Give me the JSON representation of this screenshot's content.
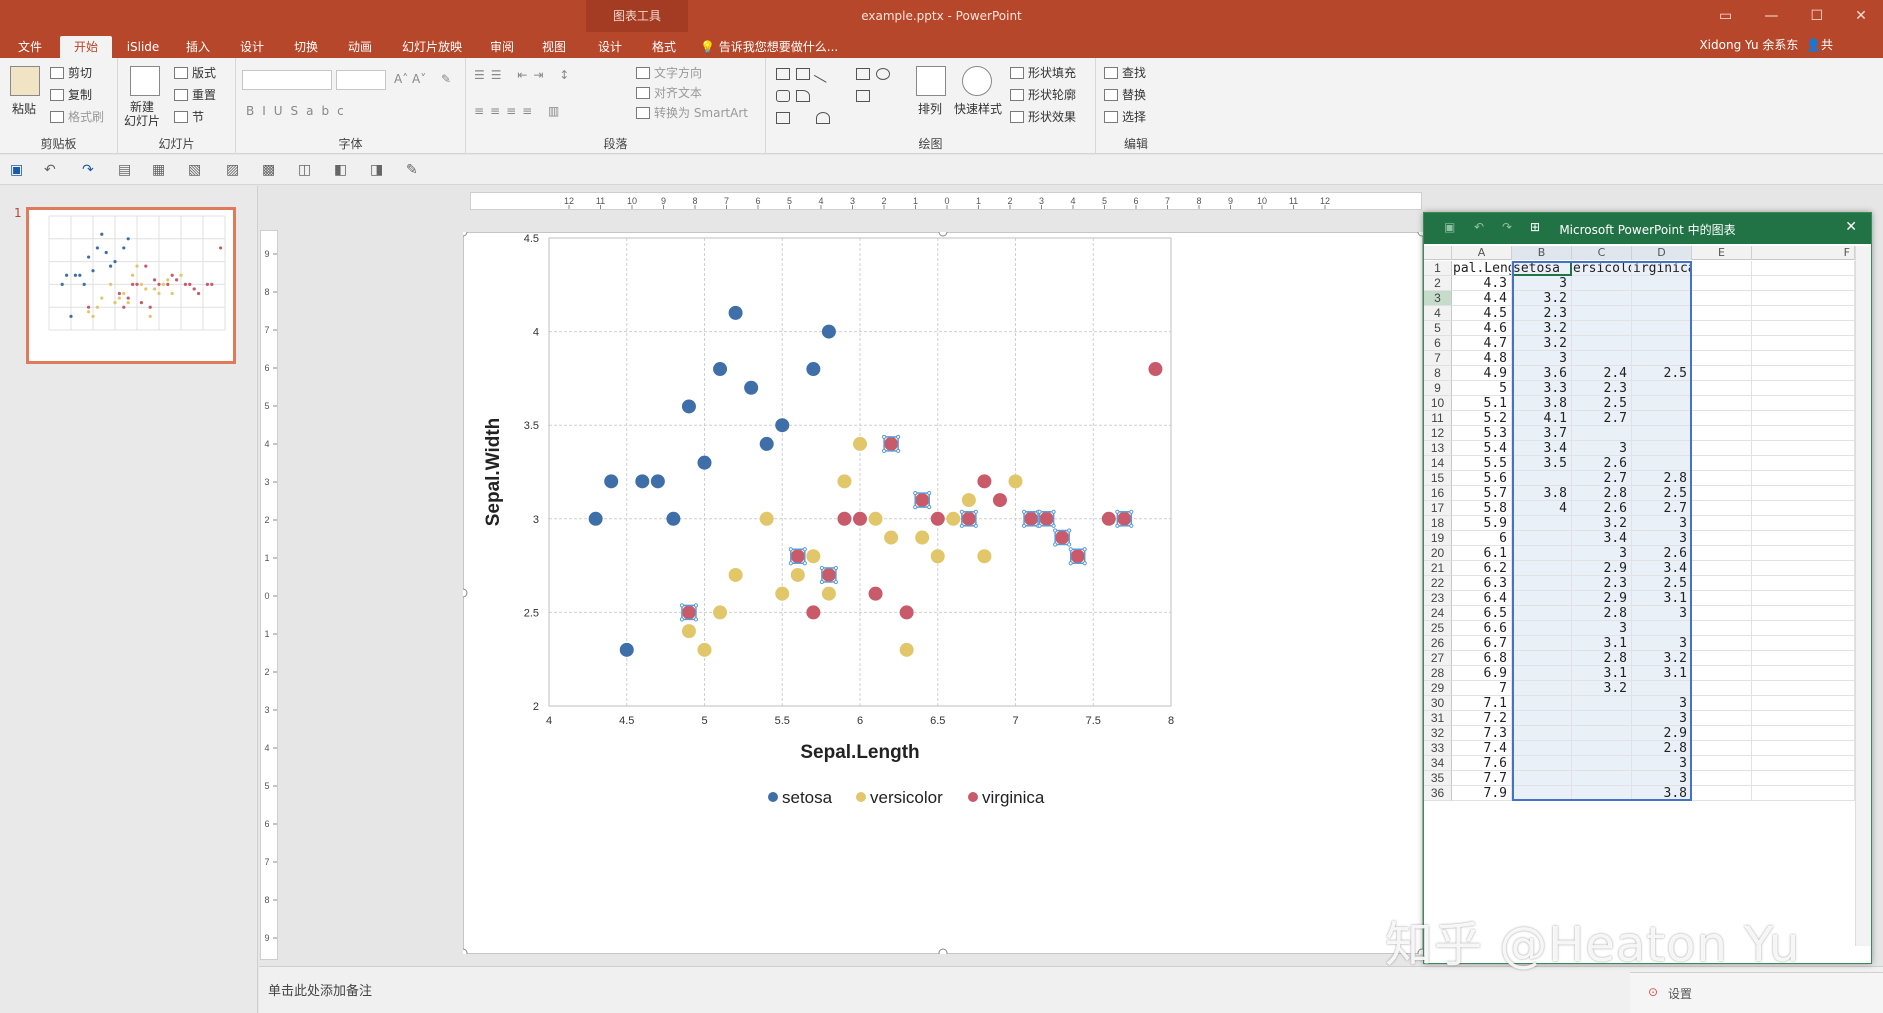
{
  "window": {
    "title": "example.pptx - PowerPoint",
    "chart_tools": "图表工具",
    "user": "Xidong Yu 余系东",
    "share": "共"
  },
  "tabs": [
    "文件",
    "开始",
    "iSlide",
    "插入",
    "设计",
    "切换",
    "动画",
    "幻灯片放映",
    "审阅",
    "视图",
    "设计",
    "格式"
  ],
  "tell_me": "告诉我您想要做什么...",
  "ribbon": {
    "clipboard": {
      "label": "剪贴板",
      "paste": "粘贴",
      "cut": "剪切",
      "copy": "复制",
      "format_painter": "格式刷"
    },
    "slides": {
      "label": "幻灯片",
      "new_slide": "新建\n幻灯片",
      "layout": "版式",
      "reset": "重置",
      "section": "节"
    },
    "font": {
      "label": "字体"
    },
    "paragraph": {
      "label": "段落",
      "text_direction": "文字方向",
      "align_text": "对齐文本",
      "convert_smartart": "转换为 SmartArt"
    },
    "drawing": {
      "label": "绘图",
      "arrange": "排列",
      "quick_styles": "快速样式",
      "shape_fill": "形状填充",
      "shape_outline": "形状轮廓",
      "shape_effects": "形状效果"
    },
    "editing": {
      "label": "编辑",
      "find": "查找",
      "replace": "替换",
      "select": "选择"
    }
  },
  "thumbnail": {
    "number": "1"
  },
  "notes_placeholder": "单击此处添加备注",
  "settings_label": "设置",
  "watermark": "知乎 @Heaton Yu",
  "sheet": {
    "title": "Microsoft PowerPoint 中的图表",
    "columns": [
      "A",
      "B",
      "C",
      "D",
      "E",
      "F"
    ],
    "header_cells": [
      "pal.Leng",
      "setosa",
      "ersicolo",
      "irginica"
    ],
    "rows": [
      [
        "4.3",
        "3",
        "",
        ""
      ],
      [
        "4.4",
        "3.2",
        "",
        ""
      ],
      [
        "4.5",
        "2.3",
        "",
        ""
      ],
      [
        "4.6",
        "3.2",
        "",
        ""
      ],
      [
        "4.7",
        "3.2",
        "",
        ""
      ],
      [
        "4.8",
        "3",
        "",
        ""
      ],
      [
        "4.9",
        "3.6",
        "2.4",
        "2.5"
      ],
      [
        "5",
        "3.3",
        "2.3",
        ""
      ],
      [
        "5.1",
        "3.8",
        "2.5",
        ""
      ],
      [
        "5.2",
        "4.1",
        "2.7",
        ""
      ],
      [
        "5.3",
        "3.7",
        "",
        ""
      ],
      [
        "5.4",
        "3.4",
        "3",
        ""
      ],
      [
        "5.5",
        "3.5",
        "2.6",
        ""
      ],
      [
        "5.6",
        "",
        "2.7",
        "2.8"
      ],
      [
        "5.7",
        "3.8",
        "2.8",
        "2.5"
      ],
      [
        "5.8",
        "4",
        "2.6",
        "2.7"
      ],
      [
        "5.9",
        "",
        "3.2",
        "3"
      ],
      [
        "6",
        "",
        "3.4",
        "3"
      ],
      [
        "6.1",
        "",
        "3",
        "2.6"
      ],
      [
        "6.2",
        "",
        "2.9",
        "3.4"
      ],
      [
        "6.3",
        "",
        "2.3",
        "2.5"
      ],
      [
        "6.4",
        "",
        "2.9",
        "3.1"
      ],
      [
        "6.5",
        "",
        "2.8",
        "3"
      ],
      [
        "6.6",
        "",
        "3",
        ""
      ],
      [
        "6.7",
        "",
        "3.1",
        "3"
      ],
      [
        "6.8",
        "",
        "2.8",
        "3.2"
      ],
      [
        "6.9",
        "",
        "3.1",
        "3.1"
      ],
      [
        "7",
        "",
        "3.2",
        ""
      ],
      [
        "7.1",
        "",
        "",
        "3"
      ],
      [
        "7.2",
        "",
        "",
        "3"
      ],
      [
        "7.3",
        "",
        "",
        "2.9"
      ],
      [
        "7.4",
        "",
        "",
        "2.8"
      ],
      [
        "7.6",
        "",
        "",
        "3"
      ],
      [
        "7.7",
        "",
        "",
        "3"
      ],
      [
        "7.9",
        "",
        "",
        "3.8"
      ]
    ]
  },
  "chart_data": {
    "type": "scatter",
    "title": "",
    "xlabel": "Sepal.Length",
    "ylabel": "Sepal.Width",
    "xlim": [
      4,
      8
    ],
    "ylim": [
      2,
      4.5
    ],
    "xticks": [
      "4",
      "4.5",
      "5",
      "5.5",
      "6",
      "6.5",
      "7",
      "7.5",
      "8"
    ],
    "yticks": [
      "2",
      "2.5",
      "3",
      "3.5",
      "4",
      "4.5"
    ],
    "grid": true,
    "legend": "bottom",
    "series": [
      {
        "name": "setosa",
        "color": "#3f6fa8",
        "points": [
          [
            4.3,
            3
          ],
          [
            4.4,
            3.2
          ],
          [
            4.5,
            2.3
          ],
          [
            4.6,
            3.2
          ],
          [
            4.7,
            3.2
          ],
          [
            4.8,
            3
          ],
          [
            4.9,
            3.6
          ],
          [
            5,
            3.3
          ],
          [
            5.1,
            3.8
          ],
          [
            5.2,
            4.1
          ],
          [
            5.3,
            3.7
          ],
          [
            5.4,
            3.4
          ],
          [
            5.5,
            3.5
          ],
          [
            5.7,
            3.8
          ],
          [
            5.8,
            4
          ]
        ]
      },
      {
        "name": "versicolor",
        "color": "#e2c66a",
        "points": [
          [
            4.9,
            2.4
          ],
          [
            5,
            2.3
          ],
          [
            5.1,
            2.5
          ],
          [
            5.2,
            2.7
          ],
          [
            5.4,
            3
          ],
          [
            5.5,
            2.6
          ],
          [
            5.6,
            2.7
          ],
          [
            5.7,
            2.8
          ],
          [
            5.8,
            2.6
          ],
          [
            5.9,
            3.2
          ],
          [
            6,
            3.4
          ],
          [
            6.1,
            3
          ],
          [
            6.2,
            2.9
          ],
          [
            6.3,
            2.3
          ],
          [
            6.4,
            2.9
          ],
          [
            6.5,
            2.8
          ],
          [
            6.6,
            3
          ],
          [
            6.7,
            3.1
          ],
          [
            6.8,
            2.8
          ],
          [
            7,
            3.2
          ]
        ]
      },
      {
        "name": "virginica",
        "color": "#c85a6a",
        "points": [
          [
            4.9,
            2.5
          ],
          [
            5.6,
            2.8
          ],
          [
            5.7,
            2.5
          ],
          [
            5.8,
            2.7
          ],
          [
            5.9,
            3
          ],
          [
            6,
            3
          ],
          [
            6.1,
            2.6
          ],
          [
            6.2,
            3.4
          ],
          [
            6.3,
            2.5
          ],
          [
            6.4,
            3.1
          ],
          [
            6.5,
            3
          ],
          [
            6.7,
            3
          ],
          [
            6.8,
            3.2
          ],
          [
            6.9,
            3.1
          ],
          [
            7.1,
            3
          ],
          [
            7.2,
            3
          ],
          [
            7.3,
            2.9
          ],
          [
            7.4,
            2.8
          ],
          [
            7.6,
            3
          ],
          [
            7.7,
            3
          ],
          [
            7.9,
            3.8
          ]
        ]
      }
    ],
    "selected_series": "virginica"
  }
}
